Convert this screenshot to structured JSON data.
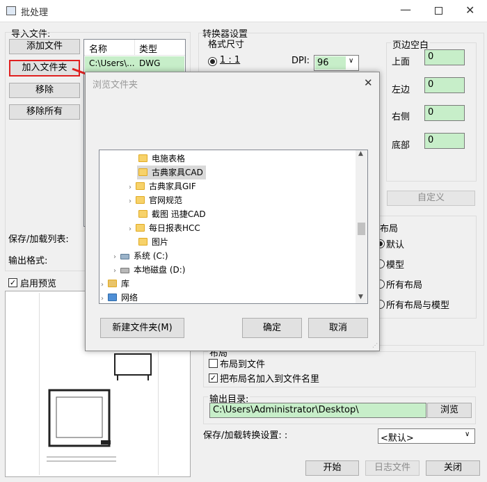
{
  "window": {
    "title": "批处理"
  },
  "import": {
    "group_label": "导入文件:",
    "add_file": "添加文件",
    "add_folder": "加入文件夹",
    "remove": "移除",
    "remove_all": "移除所有",
    "columns": [
      "名称",
      "类型"
    ],
    "rows": [
      {
        "name": "C:\\Users\\...",
        "type": "DWG"
      }
    ],
    "save_load_list": "保存/加载列表:",
    "output_format": "输出格式:",
    "enable_preview": "启用预览"
  },
  "converter": {
    "title": "转换器设置",
    "format_size": "格式尺寸",
    "ratio": "1 : 1",
    "dpi_label": "DPI:",
    "dpi_value": "96"
  },
  "margins": {
    "title": "页边空白",
    "top_label": "上面",
    "top_value": "0",
    "left_label": "左边",
    "left_value": "0",
    "right_label": "右侧",
    "right_value": "0",
    "bottom_label": "底部",
    "bottom_value": "0",
    "custom": "自定义"
  },
  "layout": {
    "title": "布局",
    "options": [
      "默认",
      "模型",
      "所有布局",
      "所有布局与模型"
    ]
  },
  "layout2": {
    "title": "布局",
    "layout_to_file": "布局到文件",
    "add_layout_name": "把布局名加入到文件名里"
  },
  "output": {
    "label": "输出目录:",
    "path": "C:\\Users\\Administrator\\Desktop\\",
    "browse": "浏览",
    "save_load_settings": "保存/加载转换设置: :",
    "settings_value": "<默认>"
  },
  "bottom": {
    "start": "开始",
    "log": "日志文件",
    "close": "关闭"
  },
  "dialog": {
    "title": "浏览文件夹",
    "new_folder": "新建文件夹(M)",
    "ok": "确定",
    "cancel": "取消",
    "tree": [
      {
        "label": "电施表格"
      },
      {
        "label": "古典家具CAD"
      },
      {
        "label": "古典家具GIF"
      },
      {
        "label": "官网规范"
      },
      {
        "label": "截图 迅捷CAD"
      },
      {
        "label": "每日报表HCC"
      },
      {
        "label": "图片"
      },
      {
        "label": "系统 (C:)"
      },
      {
        "label": "本地磁盘 (D:)"
      },
      {
        "label": "库"
      },
      {
        "label": "网络"
      }
    ]
  },
  "colors": {
    "accent_red": "#e02020",
    "field_green": "#c7eec9",
    "selection": "#d9d9d9"
  }
}
